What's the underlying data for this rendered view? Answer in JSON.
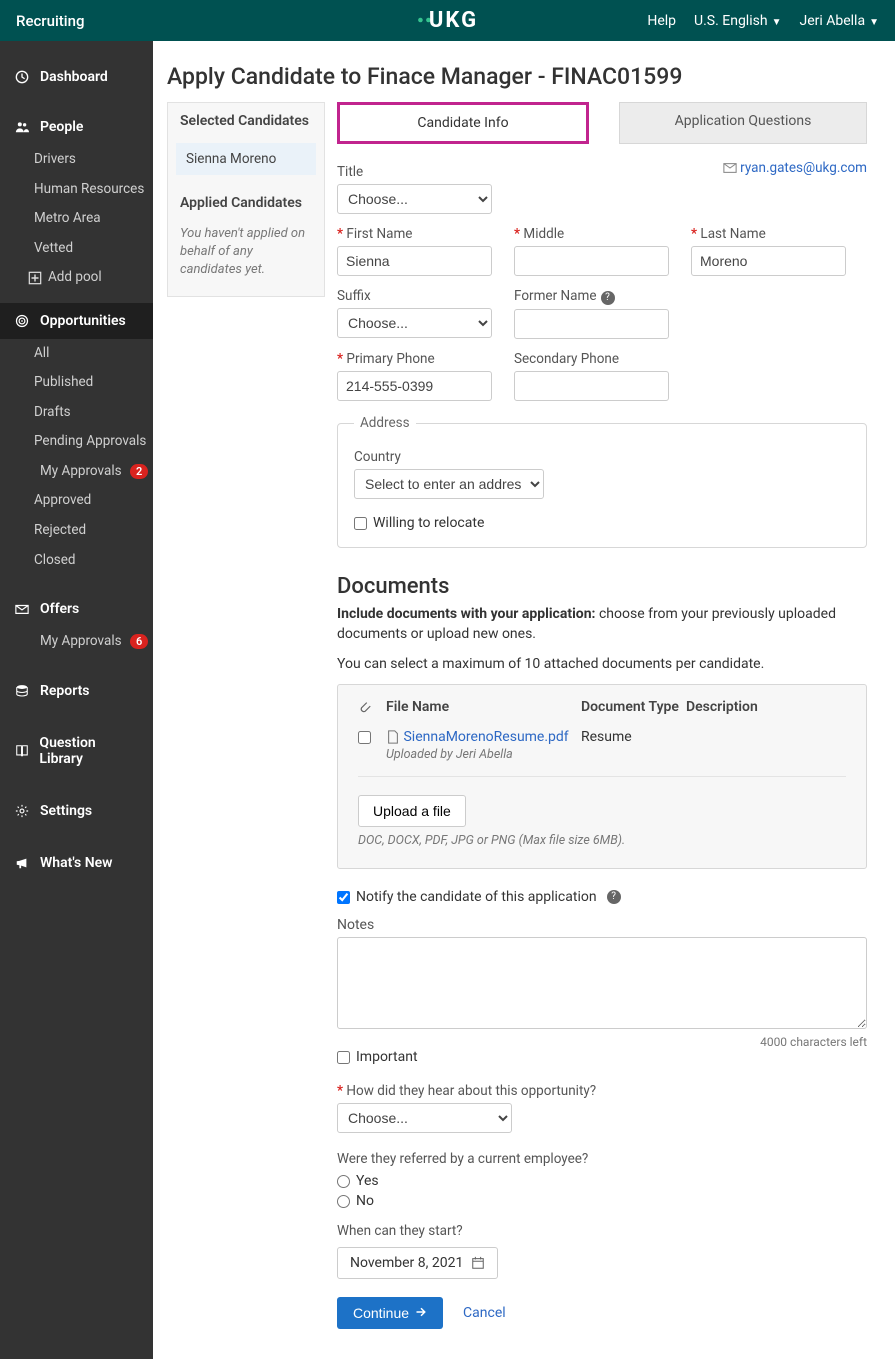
{
  "topbar": {
    "app": "Recruiting",
    "logo": "UKG",
    "help": "Help",
    "locale": "U.S. English",
    "user": "Jeri Abella"
  },
  "sidebar": {
    "dashboard": "Dashboard",
    "people": "People",
    "people_items": [
      "Drivers",
      "Human Resources",
      "Metro Area",
      "Vetted"
    ],
    "add_pool": "Add pool",
    "opportunities": "Opportunities",
    "opp_items": [
      "All",
      "Published",
      "Drafts",
      "Pending Approvals"
    ],
    "my_approvals": "My Approvals",
    "my_approvals_badge": "2",
    "opp_items2": [
      "Approved",
      "Rejected",
      "Closed"
    ],
    "offers": "Offers",
    "offers_my_approvals": "My Approvals",
    "offers_badge": "6",
    "reports": "Reports",
    "question_library": "Question Library",
    "settings": "Settings",
    "whats_new": "What's New"
  },
  "page": {
    "title": "Apply Candidate to Finace Manager - FINAC01599"
  },
  "left_panel": {
    "selected_head": "Selected Candidates",
    "selected_item": "Sienna Moreno",
    "applied_head": "Applied Candidates",
    "applied_note": "You haven't applied on behalf of any candidates yet."
  },
  "tabs": {
    "info": "Candidate Info",
    "questions": "Application Questions"
  },
  "form": {
    "title_label": "Title",
    "choose": "Choose...",
    "email": "ryan.gates@ukg.com",
    "first_name_label": "First Name",
    "first_name": "Sienna",
    "middle_label": "Middle",
    "last_name_label": "Last Name",
    "last_name": "Moreno",
    "suffix_label": "Suffix",
    "former_name_label": "Former Name",
    "primary_phone_label": "Primary Phone",
    "primary_phone": "214-555-0399",
    "secondary_phone_label": "Secondary Phone",
    "address_legend": "Address",
    "country_label": "Country",
    "country_placeholder": "Select to enter an address ...",
    "relocate_label": "Willing to relocate"
  },
  "documents": {
    "heading": "Documents",
    "note_bold": "Include documents with your application:",
    "note_rest": " choose from your previously uploaded documents or upload new ones.",
    "limit": "You can select a maximum of 10 attached documents per candidate.",
    "col_file": "File Name",
    "col_type": "Document Type",
    "col_desc": "Description",
    "file_name": "SiennaMorenoResume.pdf",
    "uploaded_by": "Uploaded by Jeri Abella",
    "file_type": "Resume",
    "upload_btn": "Upload a file",
    "upload_hint": "DOC, DOCX, PDF, JPG or PNG (Max file size 6MB)."
  },
  "notify": {
    "label": "Notify the candidate of this application",
    "notes_label": "Notes",
    "chars_left": "4000 characters left",
    "important_label": "Important"
  },
  "hear": {
    "label": "How did they hear about this opportunity?",
    "choose": "Choose..."
  },
  "referral": {
    "label": "Were they referred by a current employee?",
    "yes": "Yes",
    "no": "No"
  },
  "start": {
    "label": "When can they start?",
    "date": "November 8, 2021"
  },
  "actions": {
    "continue": "Continue",
    "cancel": "Cancel"
  }
}
